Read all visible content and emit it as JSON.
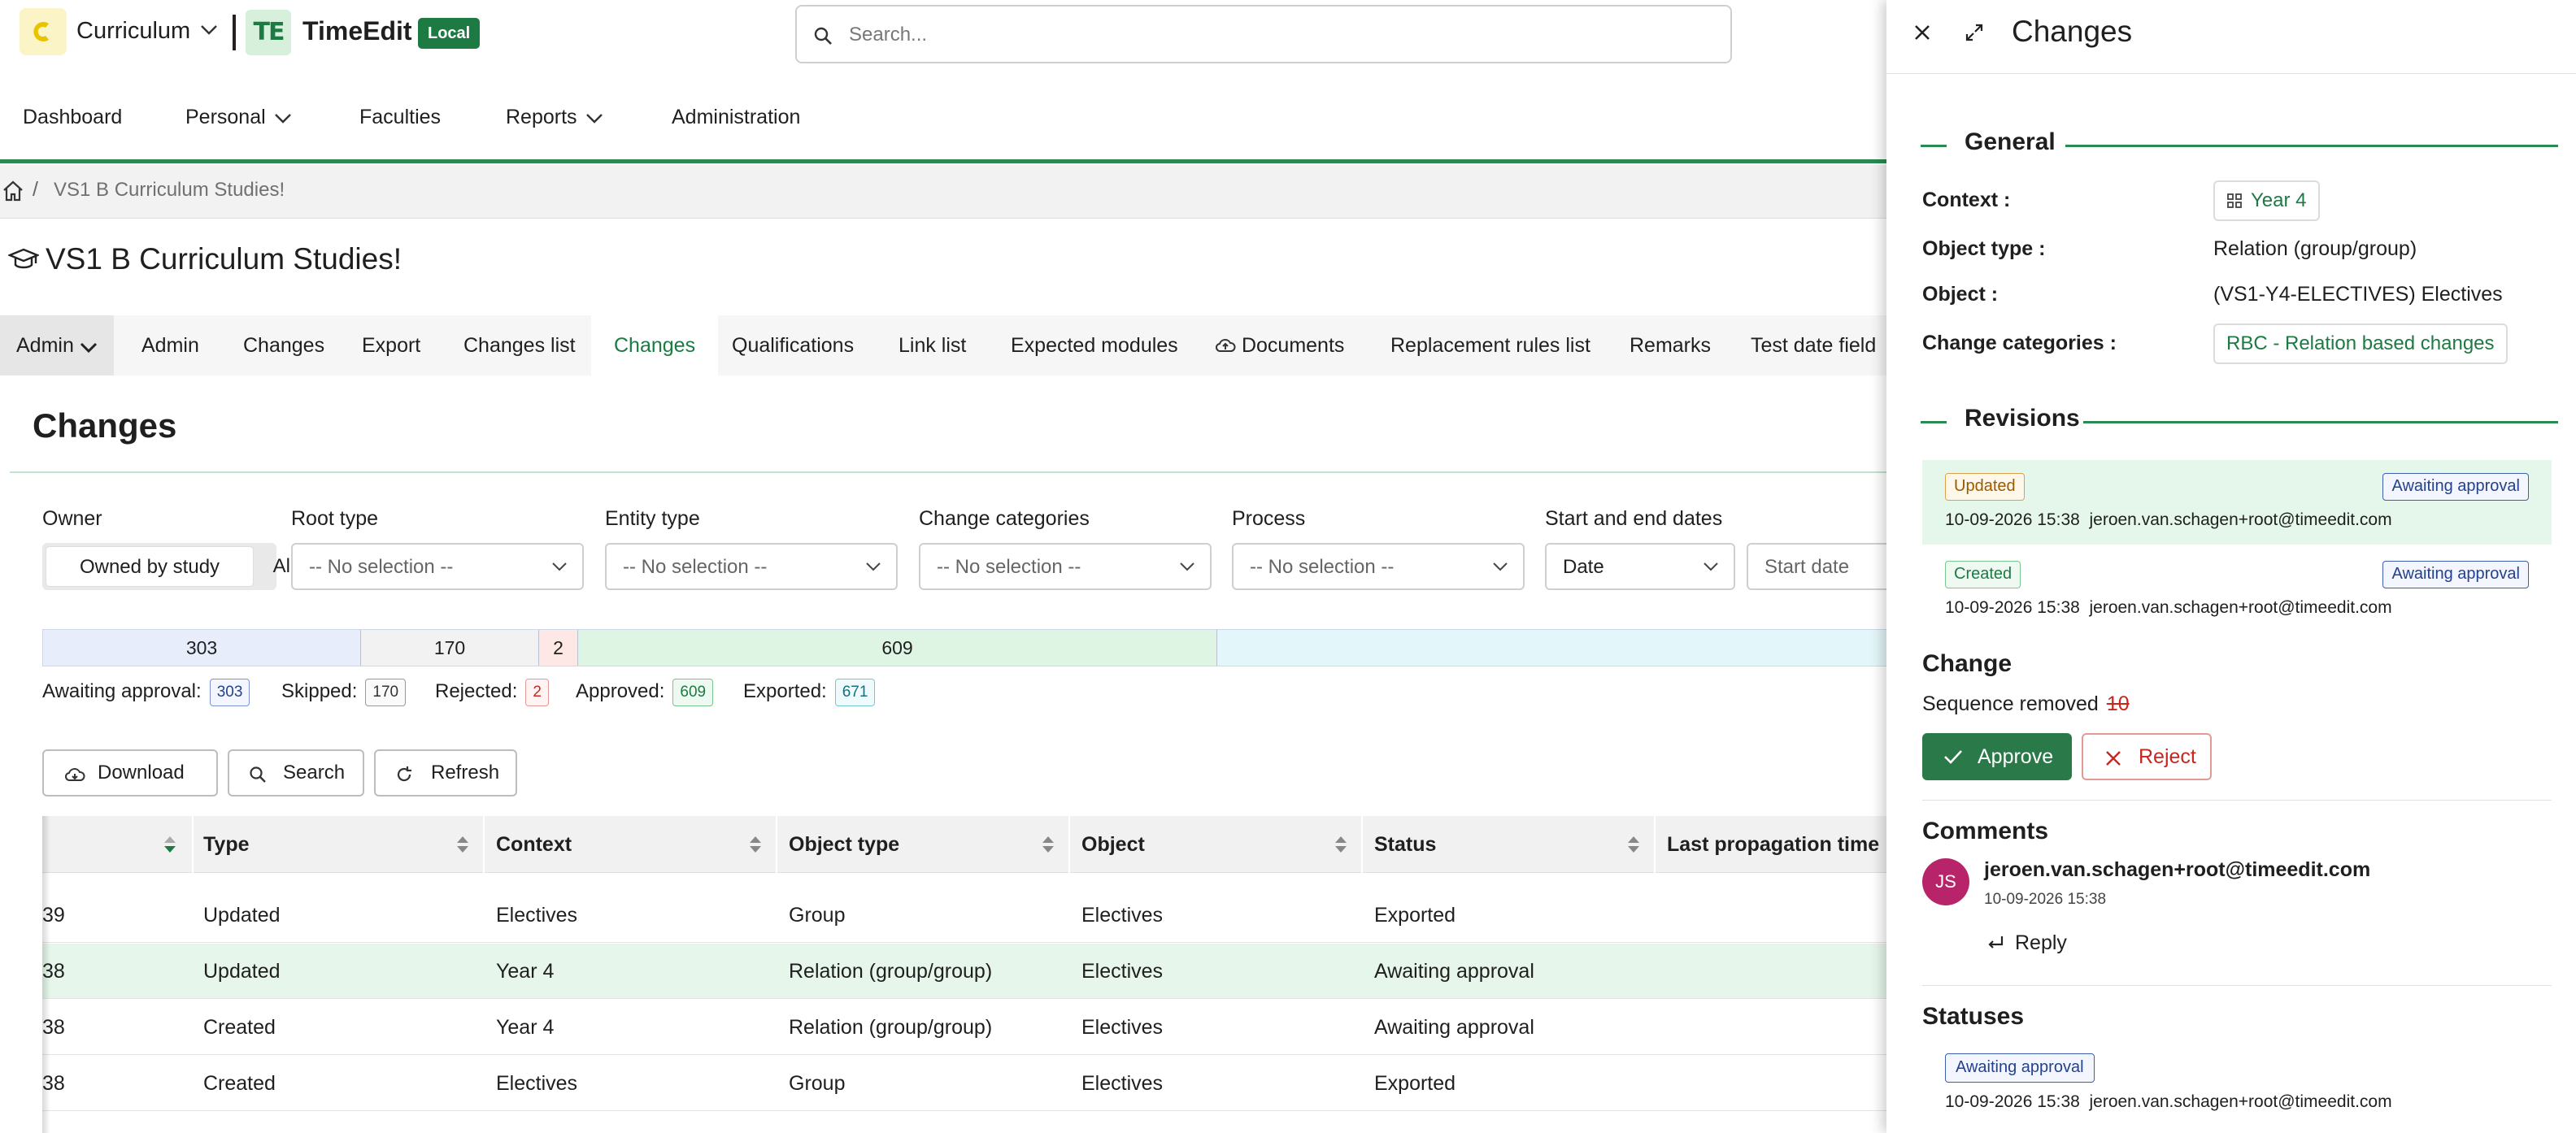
{
  "header": {
    "app_name": "Curriculum",
    "brand_mark": "TE",
    "brand": "TimeEdit",
    "env_badge": "Local",
    "search_placeholder": "Search..."
  },
  "nav": {
    "items": [
      {
        "label": "Dashboard"
      },
      {
        "label": "Personal"
      },
      {
        "label": "Faculties"
      },
      {
        "label": "Reports"
      },
      {
        "label": "Administration"
      }
    ]
  },
  "breadcrumb": {
    "separator": "/",
    "current": "VS1 B Curriculum Studies!"
  },
  "page": {
    "title": "VS1 B Curriculum Studies!"
  },
  "tabs": [
    {
      "label": "Admin"
    },
    {
      "label": "Admin"
    },
    {
      "label": "Changes"
    },
    {
      "label": "Export"
    },
    {
      "label": "Changes list"
    },
    {
      "label": "Changes"
    },
    {
      "label": "Qualifications"
    },
    {
      "label": "Link list"
    },
    {
      "label": "Expected modules"
    },
    {
      "label": "Documents"
    },
    {
      "label": "Replacement rules list"
    },
    {
      "label": "Remarks"
    },
    {
      "label": "Test date field"
    }
  ],
  "section": {
    "title": "Changes"
  },
  "filters": {
    "owner": {
      "label": "Owner",
      "options": [
        "Owned by study",
        "All"
      ]
    },
    "root_type": {
      "label": "Root type",
      "value": "-- No selection --"
    },
    "entity_type": {
      "label": "Entity type",
      "value": "-- No selection --"
    },
    "change_categories": {
      "label": "Change categories",
      "value": "-- No selection --"
    },
    "process": {
      "label": "Process",
      "value": "-- No selection --"
    },
    "dates": {
      "label": "Start and end dates",
      "type_value": "Date",
      "start_placeholder": "Start date"
    }
  },
  "progress": {
    "segments": [
      {
        "label": "303",
        "value": 303,
        "color": "#e8edfb"
      },
      {
        "label": "170",
        "value": 170,
        "color": "#f2f2f2"
      },
      {
        "label": "2",
        "value": 2,
        "color": "#fde8e6"
      },
      {
        "label": "609",
        "value": 609,
        "color": "#dff5e3"
      },
      {
        "label": "",
        "value": 671,
        "color": "#e3f6f9"
      }
    ]
  },
  "legend": {
    "awaiting": {
      "label": "Awaiting approval:",
      "count": "303"
    },
    "skipped": {
      "label": "Skipped:",
      "count": "170"
    },
    "rejected": {
      "label": "Rejected:",
      "count": "2"
    },
    "approved": {
      "label": "Approved:",
      "count": "609"
    },
    "exported": {
      "label": "Exported:",
      "count": "671"
    }
  },
  "toolbar": {
    "download": "Download",
    "search": "Search",
    "refresh": "Refresh"
  },
  "table": {
    "columns": [
      "Type",
      "Context",
      "Object type",
      "Object",
      "Status",
      "Last propagation time"
    ],
    "rows": [
      {
        "id": "39",
        "type": "Updated",
        "context": "Electives",
        "object_type": "Group",
        "object": "Electives",
        "status": "Exported"
      },
      {
        "id": "38",
        "type": "Updated",
        "context": "Year 4",
        "object_type": "Relation (group/group)",
        "object": "Electives",
        "status": "Awaiting approval"
      },
      {
        "id": "38",
        "type": "Created",
        "context": "Year 4",
        "object_type": "Relation (group/group)",
        "object": "Electives",
        "status": "Awaiting approval"
      },
      {
        "id": "38",
        "type": "Created",
        "context": "Electives",
        "object_type": "Group",
        "object": "Electives",
        "status": "Exported"
      }
    ]
  },
  "drawer": {
    "title": "Changes",
    "general": {
      "heading": "General",
      "context_label": "Context :",
      "context_value": "Year 4",
      "object_type_label": "Object type :",
      "object_type_value": "Relation (group/group)",
      "object_label": "Object :",
      "object_value": "(VS1-Y4-ELECTIVES) Electives",
      "categories_label": "Change categories :",
      "categories_value": "RBC - Relation based changes"
    },
    "revisions": {
      "heading": "Revisions",
      "items": [
        {
          "type": "Updated",
          "status": "Awaiting approval",
          "date": "10-09-2026 15:38",
          "user": "jeroen.van.schagen+root@timeedit.com"
        },
        {
          "type": "Created",
          "status": "Awaiting approval",
          "date": "10-09-2026 15:38",
          "user": "jeroen.van.schagen+root@timeedit.com"
        }
      ]
    },
    "change": {
      "heading": "Change",
      "text": "Sequence removed",
      "old_value": "10",
      "approve": "Approve",
      "reject": "Reject"
    },
    "comments": {
      "heading": "Comments",
      "initials": "JS",
      "author": "jeroen.van.schagen+root@timeedit.com",
      "date": "10-09-2026 15:38",
      "reply": "Reply"
    },
    "statuses": {
      "heading": "Statuses",
      "badge": "Awaiting approval",
      "date": "10-09-2026 15:38",
      "user": "jeroen.van.schagen+root@timeedit.com"
    }
  }
}
